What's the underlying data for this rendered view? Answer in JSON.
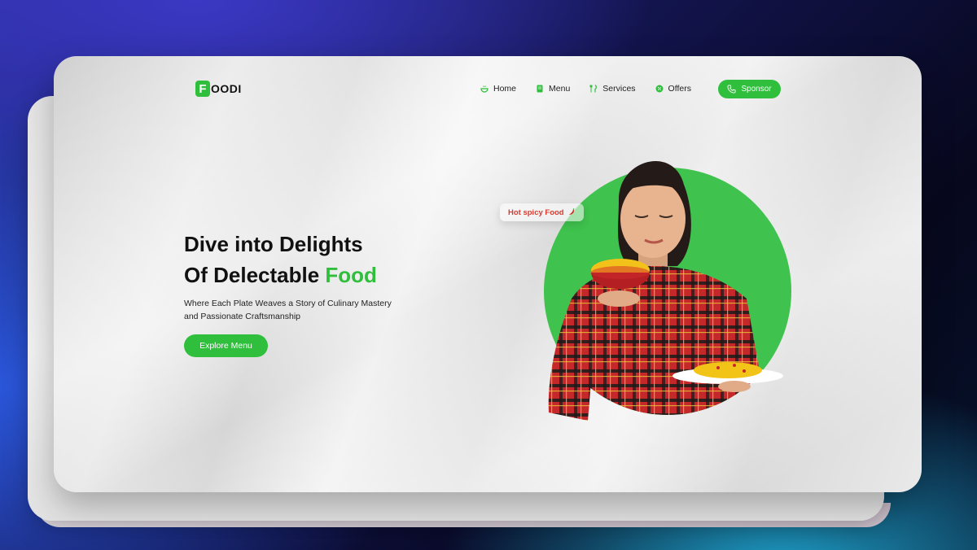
{
  "brand": {
    "mark_letter": "F",
    "name": "OODI"
  },
  "nav": {
    "items": [
      {
        "label": "Home",
        "icon": "bowl-icon"
      },
      {
        "label": "Menu",
        "icon": "menu-book-icon"
      },
      {
        "label": "Services",
        "icon": "fork-knife-icon"
      },
      {
        "label": "Offers",
        "icon": "offer-badge-icon"
      }
    ],
    "sponsor_label": "Sponsor"
  },
  "hero": {
    "title_line1": "Dive into Delights",
    "title_line2_prefix": "Of Delectable ",
    "title_line2_accent": "Food",
    "subtitle": "Where Each Plate Weaves a Story of Culinary Mastery and Passionate Craftsmanship",
    "cta_label": "Explore Menu",
    "tag_label": "Hot spicy Food"
  },
  "colors": {
    "accent": "#2fbf3c",
    "tag_text": "#d93a2e",
    "text": "#111111"
  }
}
